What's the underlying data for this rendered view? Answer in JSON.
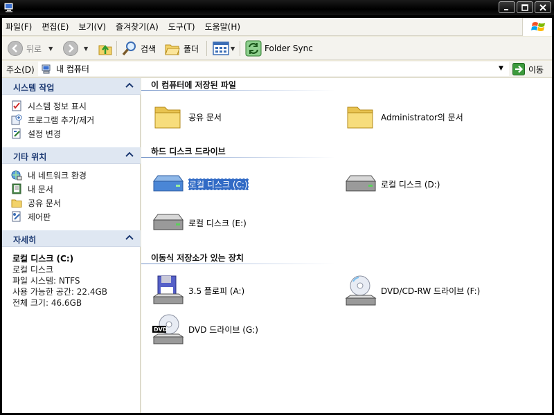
{
  "window": {
    "title": "",
    "controls": [
      "minimize",
      "maximize",
      "close"
    ]
  },
  "menu": {
    "items": [
      "파일(F)",
      "편집(E)",
      "보기(V)",
      "즐겨찾기(A)",
      "도구(T)",
      "도움말(H)"
    ]
  },
  "toolbar": {
    "back": "뒤로",
    "search": "검색",
    "folders": "폴더",
    "folder_sync": "Folder Sync"
  },
  "address": {
    "label": "주소(D)",
    "value": "내 컴퓨터",
    "go": "이동"
  },
  "left_pane": {
    "system_tasks": {
      "title": "시스템 작업",
      "items": [
        {
          "label": "시스템 정보 표시",
          "icon": "system-info-icon"
        },
        {
          "label": "프로그램 추가/제거",
          "icon": "add-remove-programs-icon"
        },
        {
          "label": "설정 변경",
          "icon": "change-settings-icon"
        }
      ]
    },
    "other_places": {
      "title": "기타 위치",
      "items": [
        {
          "label": "내 네트워크 환경",
          "icon": "network-places-icon"
        },
        {
          "label": "내 문서",
          "icon": "my-documents-icon"
        },
        {
          "label": "공유 문서",
          "icon": "shared-documents-icon"
        },
        {
          "label": "제어판",
          "icon": "control-panel-icon"
        }
      ]
    },
    "details": {
      "title": "자세히",
      "name": "로컬 디스크 (C:)",
      "type": "로컬 디스크",
      "filesystem": "파일 시스템: NTFS",
      "free_space": "사용 가능한 공간: 22.4GB",
      "total_size": "전체 크기: 46.6GB"
    }
  },
  "content": {
    "groups": [
      {
        "title": "이 컴퓨터에 저장된 파일",
        "items": [
          {
            "label": "공유 문서",
            "icon": "folder-icon"
          },
          {
            "label": "Administrator의 문서",
            "icon": "folder-icon"
          }
        ]
      },
      {
        "title": "하드 디스크 드라이브",
        "items": [
          {
            "label": "로컬 디스크 (C:)",
            "icon": "hard-drive-system-icon",
            "selected": true
          },
          {
            "label": "로컬 디스크 (D:)",
            "icon": "hard-drive-icon"
          },
          {
            "label": "로컬 디스크 (E:)",
            "icon": "hard-drive-icon"
          }
        ]
      },
      {
        "title": "이동식 저장소가 있는 장치",
        "items": [
          {
            "label": "3.5 플로피 (A:)",
            "icon": "floppy-drive-icon"
          },
          {
            "label": "DVD/CD-RW 드라이브 (F:)",
            "icon": "cd-drive-icon"
          },
          {
            "label": "DVD 드라이브 (G:)",
            "icon": "dvd-drive-icon"
          }
        ]
      }
    ]
  },
  "colors": {
    "panel_header": "#dfe7f2",
    "panel_title": "#1d3a73",
    "selection": "#316ac5",
    "chrome": "#f4f3ee"
  }
}
